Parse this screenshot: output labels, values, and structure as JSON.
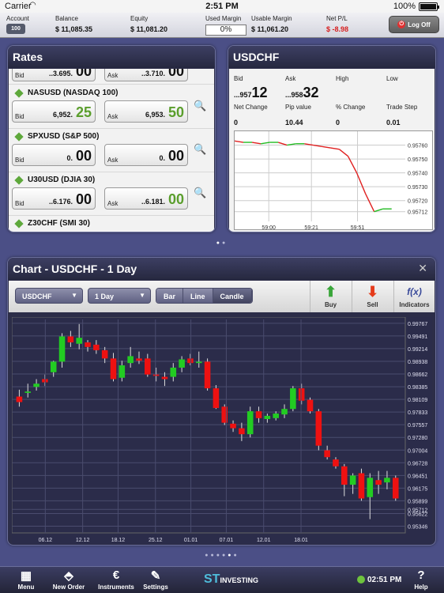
{
  "status": {
    "carrier": "Carrier",
    "time": "2:51 PM",
    "battery": "100%"
  },
  "account": {
    "account_label": "Account",
    "account_btn": "100",
    "balance_label": "Balance",
    "balance": "$ 11,085.35",
    "equity_label": "Equity",
    "equity": "$ 11,081.20",
    "used_margin_label": "Used Margin",
    "used_margin": "0%",
    "usable_margin_label": "Usable Margin",
    "usable_margin": "$ 11,061.20",
    "netpl_label": "Net P/L",
    "netpl": "$ -8.98",
    "logoff": "Log Off"
  },
  "rates": {
    "title": "Rates",
    "rows": [
      {
        "symbol": "",
        "bid_pre": "..3.695.",
        "bid_big": "00",
        "ask_pre": "..3.710.",
        "ask_big": "00"
      },
      {
        "symbol": "NASUSD (NASDAQ 100)",
        "bid_pre": "6,952.",
        "bid_big": "25",
        "ask_pre": "6,953.",
        "ask_big": "50"
      },
      {
        "symbol": "SPXUSD (S&P 500)",
        "bid_pre": "0.",
        "bid_big": "00",
        "ask_pre": "0.",
        "ask_big": "00"
      },
      {
        "symbol": "U30USD (DJIA 30)",
        "bid_pre": "..6.176.",
        "bid_big": "00",
        "ask_pre": "..6.181.",
        "ask_big": "00"
      },
      {
        "symbol": "Z30CHF (SMI 30)",
        "bid_pre": "",
        "bid_big": "",
        "ask_pre": "",
        "ask_big": ""
      }
    ],
    "bid_label": "Bid",
    "ask_label": "Ask"
  },
  "usdchf": {
    "title": "USDCHF",
    "bid_label": "Bid",
    "ask_label": "Ask",
    "high_label": "High",
    "low_label": "Low",
    "bid_pre": "...957",
    "bid_big": "12",
    "ask_pre": "...958",
    "ask_big": "32",
    "net_change_label": "Net Change",
    "pip_label": "Pip value",
    "pct_label": "% Change",
    "step_label": "Trade Step",
    "net_change": "0",
    "pip": "10.44",
    "pct": "0",
    "step": "0.01",
    "mini_yticks": [
      "0.95760",
      "0.95750",
      "0.95740",
      "0.95730",
      "0.95720",
      "0.95712"
    ],
    "mini_xticks": [
      "59:00",
      "59:21",
      "59:51"
    ]
  },
  "chart": {
    "title": "Chart - USDCHF - 1 Day",
    "symbol_dd": "USDCHF",
    "period_dd": "1 Day",
    "seg": [
      "Bar",
      "Line",
      "Candle"
    ],
    "buy": "Buy",
    "sell": "Sell",
    "indicators": "Indicators",
    "accent_buy": "#3aa63a",
    "accent_sell": "#e53b1b"
  },
  "chart_data": {
    "type": "candlestick",
    "title": "Chart - USDCHF - 1 Day",
    "x_ticks": [
      "06.12",
      "12.12",
      "18.12",
      "25.12",
      "01.01",
      "07.01",
      "12.01",
      "18.01"
    ],
    "y_ticks": [
      "0.99767",
      "0.99491",
      "0.99214",
      "0.98938",
      "0.98662",
      "0.98385",
      "0.98109",
      "0.97833",
      "0.97557",
      "0.97280",
      "0.97004",
      "0.96728",
      "0.96451",
      "0.96175",
      "0.95899",
      "0.95712",
      "0.95622",
      "0.95346"
    ],
    "ylim": [
      0.952,
      0.9985
    ],
    "candles": [
      [
        0.9817,
        0.9832,
        0.9795,
        0.9805
      ],
      [
        0.9825,
        0.9845,
        0.9815,
        0.9828
      ],
      [
        0.9838,
        0.9855,
        0.983,
        0.9845
      ],
      [
        0.9855,
        0.9865,
        0.984,
        0.9848
      ],
      [
        0.987,
        0.9895,
        0.986,
        0.9893
      ],
      [
        0.9893,
        0.9955,
        0.988,
        0.9948
      ],
      [
        0.9948,
        0.996,
        0.9925,
        0.9935
      ],
      [
        0.9932,
        0.9975,
        0.992,
        0.9945
      ],
      [
        0.9935,
        0.994,
        0.9915,
        0.9925
      ],
      [
        0.993,
        0.994,
        0.991,
        0.9918
      ],
      [
        0.9918,
        0.9925,
        0.989,
        0.99
      ],
      [
        0.99,
        0.9912,
        0.985,
        0.9855
      ],
      [
        0.9858,
        0.9895,
        0.985,
        0.9885
      ],
      [
        0.989,
        0.9925,
        0.988,
        0.9905
      ],
      [
        0.99,
        0.9915,
        0.9888,
        0.9895
      ],
      [
        0.99,
        0.991,
        0.986,
        0.9865
      ],
      [
        0.9865,
        0.988,
        0.985,
        0.9862
      ],
      [
        0.986,
        0.987,
        0.984,
        0.9855
      ],
      [
        0.986,
        0.989,
        0.985,
        0.988
      ],
      [
        0.988,
        0.9905,
        0.987,
        0.9898
      ],
      [
        0.99,
        0.991,
        0.9885,
        0.989
      ],
      [
        0.989,
        0.9915,
        0.988,
        0.9893
      ],
      [
        0.9893,
        0.99,
        0.983,
        0.9835
      ],
      [
        0.9835,
        0.9842,
        0.979,
        0.9792
      ],
      [
        0.9795,
        0.98,
        0.9755,
        0.976
      ],
      [
        0.9758,
        0.9765,
        0.974,
        0.9748
      ],
      [
        0.9748,
        0.976,
        0.972,
        0.9735
      ],
      [
        0.9735,
        0.9795,
        0.9728,
        0.9785
      ],
      [
        0.9785,
        0.9795,
        0.976,
        0.977
      ],
      [
        0.9768,
        0.978,
        0.976,
        0.9775
      ],
      [
        0.977,
        0.9785,
        0.9765,
        0.978
      ],
      [
        0.9778,
        0.98,
        0.977,
        0.979
      ],
      [
        0.979,
        0.984,
        0.9785,
        0.9835
      ],
      [
        0.9835,
        0.9845,
        0.98,
        0.9808
      ],
      [
        0.981,
        0.9815,
        0.978,
        0.9785
      ],
      [
        0.9785,
        0.979,
        0.97,
        0.971
      ],
      [
        0.97,
        0.971,
        0.968,
        0.9685
      ],
      [
        0.968,
        0.9685,
        0.966,
        0.9665
      ],
      [
        0.9665,
        0.967,
        0.96,
        0.9625
      ],
      [
        0.9625,
        0.965,
        0.9605,
        0.9645
      ],
      [
        0.965,
        0.966,
        0.959,
        0.9595
      ],
      [
        0.9598,
        0.965,
        0.955,
        0.964
      ],
      [
        0.9635,
        0.9655,
        0.9605,
        0.9625
      ],
      [
        0.963,
        0.9655,
        0.9615,
        0.964
      ],
      [
        0.964,
        0.9645,
        0.959,
        0.9595
      ]
    ],
    "mini_line": [
      0.95763,
      0.95762,
      0.95762,
      0.95761,
      0.95762,
      0.95762,
      0.9576,
      0.95761,
      0.95761,
      0.9576,
      0.95759,
      0.95758,
      0.95757,
      0.95752,
      0.9574,
      0.95725,
      0.95712,
      0.95714,
      0.95714
    ],
    "colors": {
      "up": "#22cc22",
      "down": "#ee1111",
      "line": "#e02020"
    }
  },
  "bottom": {
    "menu": "Menu",
    "new_order": "New Order",
    "instruments": "Instruments",
    "settings": "Settings",
    "brand": "INVESTING",
    "time": "02:51 PM",
    "help": "Help"
  }
}
